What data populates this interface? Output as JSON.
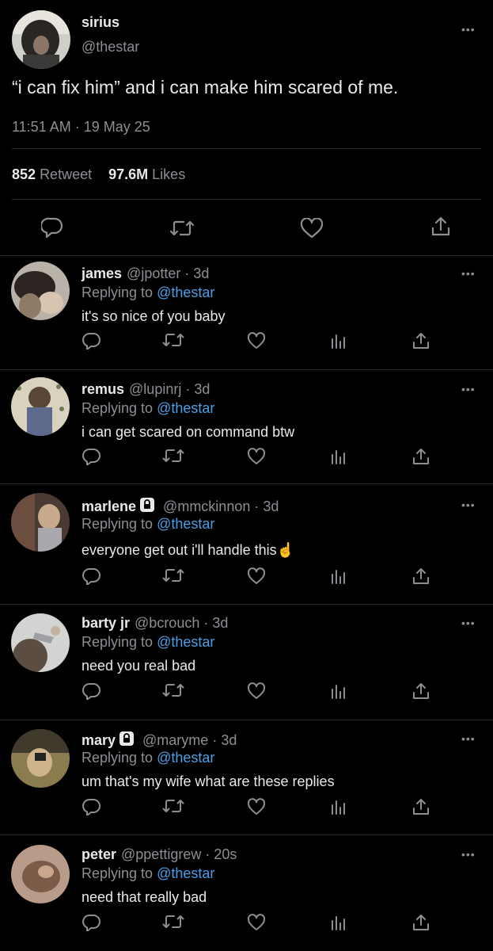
{
  "main": {
    "name": "sirius",
    "handle": "@thestar",
    "text": "“i can fix him” and i can make him scared of me.",
    "timestamp": "11:51 AM · 19 May 25",
    "retweet_count": "852",
    "retweet_label": "Retweet",
    "likes_count": "97.6M",
    "likes_label": "Likes",
    "more": "•••"
  },
  "replies": [
    {
      "name": "james",
      "handle": "@jpotter",
      "sep": "·",
      "time": "3d",
      "replying_prefix": "Replying to",
      "replying_to": "@thestar",
      "text": "it's so nice of you baby",
      "locked": false,
      "more": "•••"
    },
    {
      "name": "remus",
      "handle": "@lupinrj",
      "sep": "·",
      "time": "3d",
      "replying_prefix": "Replying to",
      "replying_to": "@thestar",
      "text": "i can get scared on command btw",
      "locked": false,
      "more": "•••"
    },
    {
      "name": "marlene",
      "handle": "@mmckinnon",
      "sep": "·",
      "time": "3d",
      "replying_prefix": "Replying to",
      "replying_to": "@thestar",
      "text": "everyone get out i'll handle this☝️",
      "locked": true,
      "more": "•••"
    },
    {
      "name": "barty jr",
      "handle": "@bcrouch",
      "sep": "·",
      "time": "3d",
      "replying_prefix": "Replying to",
      "replying_to": "@thestar",
      "text": "need you real bad",
      "locked": false,
      "more": "•••"
    },
    {
      "name": "mary",
      "handle": "@maryme",
      "sep": "·",
      "time": "3d",
      "replying_prefix": "Replying to",
      "replying_to": "@thestar",
      "text": "um that's my wife what are these replies",
      "locked": true,
      "more": "•••"
    },
    {
      "name": "peter",
      "handle": "@ppettigrew",
      "sep": "·",
      "time": "20s",
      "replying_prefix": "Replying to",
      "replying_to": "@thestar",
      "text": "need that really bad",
      "locked": false,
      "more": "•••"
    }
  ],
  "icons": {
    "reply": "reply-icon",
    "retweet": "retweet-icon",
    "like": "heart-icon",
    "views": "analytics-icon",
    "share": "share-icon",
    "lock": "lock-icon",
    "more": "more-icon"
  },
  "colors": {
    "background": "#000000",
    "text": "#e7e9ea",
    "secondary": "#8b8f94",
    "link": "#4b9fe6",
    "divider": "#2b2e31"
  }
}
